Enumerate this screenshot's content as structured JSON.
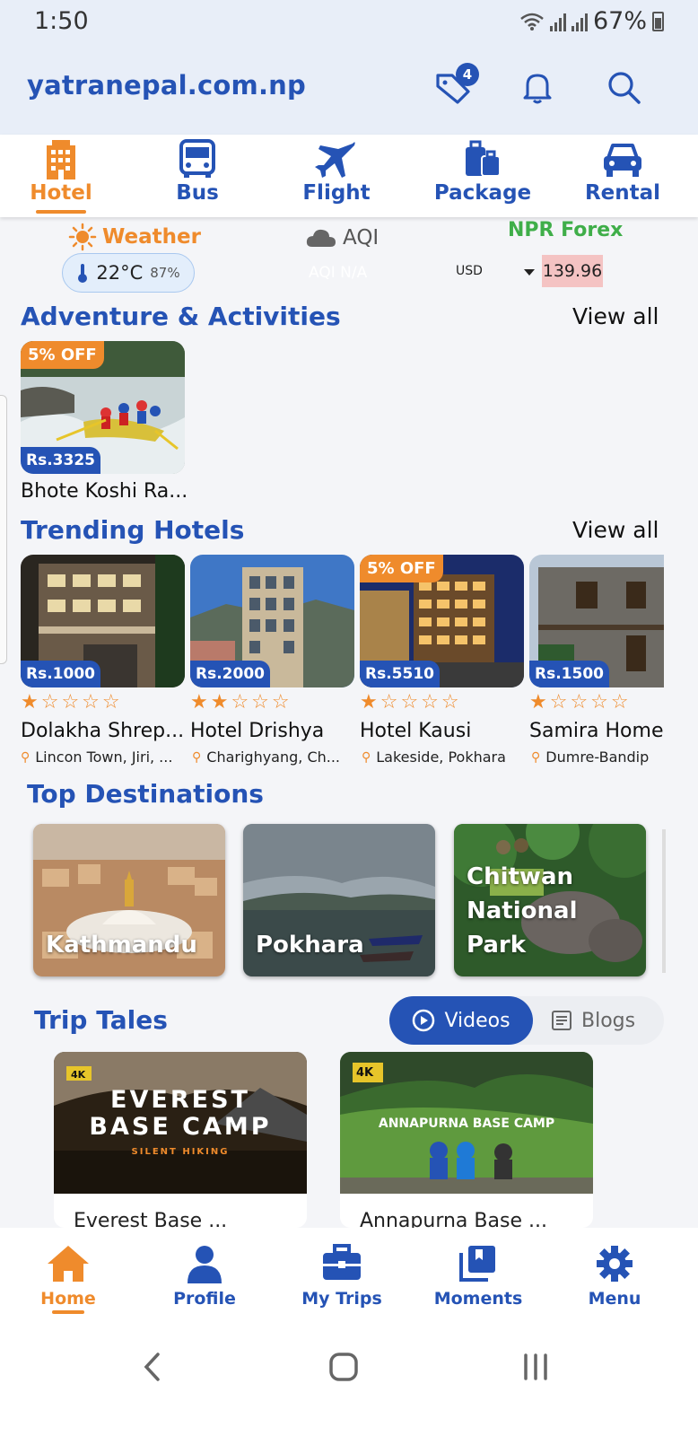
{
  "status_bar": {
    "time": "1:50",
    "battery": "67%"
  },
  "header": {
    "brand": "yatranepal.com.np",
    "wishlist_count": "4"
  },
  "categories": [
    {
      "label": "Hotel",
      "icon": "hotel-icon",
      "active": true
    },
    {
      "label": "Bus",
      "icon": "bus-icon"
    },
    {
      "label": "Flight",
      "icon": "flight-icon"
    },
    {
      "label": "Package",
      "icon": "package-icon"
    },
    {
      "label": "Rental",
      "icon": "car-icon"
    }
  ],
  "weather": {
    "title": "Weather",
    "temp": "22°C",
    "humidity": "87%"
  },
  "aqi": {
    "title": "AQI",
    "value": "AQI N/A"
  },
  "forex": {
    "title": "NPR Forex",
    "currency": "USD",
    "rate": "139.96"
  },
  "adventure": {
    "title": "Adventure & Activities",
    "view_all": "View all",
    "items": [
      {
        "name": "Bhote Koshi Ra...",
        "price": "Rs.3325",
        "discount": "5% OFF"
      }
    ]
  },
  "hotels": {
    "title": "Trending Hotels",
    "view_all": "View all",
    "items": [
      {
        "name": "Dolakha Shrep...",
        "price": "Rs.1000",
        "rating": 1,
        "location": "Lincon Town, Jiri, ..."
      },
      {
        "name": "Hotel Drishya",
        "price": "Rs.2000",
        "rating": 2,
        "location": "Charighyang, Ch..."
      },
      {
        "name": "Hotel Kausi",
        "price": "Rs.5510",
        "rating": 1,
        "location": "Lakeside, Pokhara",
        "discount": "5% OFF"
      },
      {
        "name": "Samira Home",
        "price": "Rs.1500",
        "rating": 1,
        "location": "Dumre-Bandip"
      }
    ]
  },
  "destinations": {
    "title": "Top Destinations",
    "items": [
      {
        "name": "Kathmandu"
      },
      {
        "name": "Pokhara"
      },
      {
        "name": "Chitwan National Park"
      }
    ]
  },
  "trip_tales": {
    "title": "Trip Tales",
    "videos_label": "Videos",
    "blogs_label": "Blogs",
    "videos": [
      {
        "title": "Everest Base ...",
        "thumb_line1": "EVEREST",
        "thumb_line2": "BASE CAMP",
        "thumb_sub": "SILENT HIKING",
        "tag": "4K"
      },
      {
        "title": "Annapurna Base ...",
        "thumb_line1": "ANNAPURNA BASE CAMP",
        "tag": "4K"
      }
    ]
  },
  "bottom_nav": [
    {
      "label": "Home",
      "icon": "home-icon",
      "active": true
    },
    {
      "label": "Profile",
      "icon": "profile-icon"
    },
    {
      "label": "My Trips",
      "icon": "briefcase-icon"
    },
    {
      "label": "Moments",
      "icon": "moments-icon"
    },
    {
      "label": "Menu",
      "icon": "gear-icon"
    }
  ],
  "colors": {
    "primary": "#2553b5",
    "accent": "#ef8b2c",
    "forex": "#3fae49"
  }
}
